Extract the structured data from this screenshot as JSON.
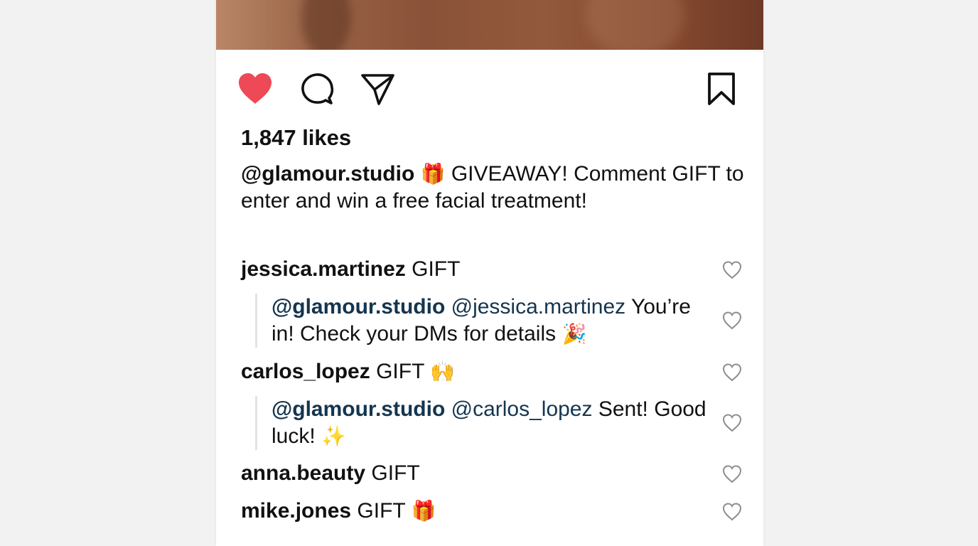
{
  "post": {
    "likes": "1,847 likes",
    "caption_user": "@glamour.studio",
    "caption_emoji": "🎁",
    "caption_text": "GIVEAWAY! Comment GIFT to enter and win a free facial treatment!"
  },
  "colors": {
    "like_active": "#ed4956",
    "mention": "#14354f",
    "icon": "#111111",
    "comment_heart": "#8e8e8e"
  },
  "actions": {
    "like_icon": "heart-filled-icon",
    "comment_icon": "comment-bubble-icon",
    "share_icon": "paper-plane-icon",
    "save_icon": "bookmark-icon"
  },
  "comments": [
    {
      "user": "jessica.martinez",
      "text": "GIFT",
      "emoji": ""
    },
    {
      "user": "carlos_lopez",
      "text": "GIFT",
      "emoji": "🙌"
    },
    {
      "user": "anna.beauty",
      "text": "GIFT",
      "emoji": ""
    },
    {
      "user": "mike.jones",
      "text": "GIFT",
      "emoji": "🎁"
    }
  ],
  "replies": [
    {
      "author": "@glamour.studio",
      "mention": "@jessica.martinez",
      "text": "You’re in! Check your DMs for details",
      "emoji": "🎉"
    },
    {
      "author": "@glamour.studio",
      "mention": "@carlos_lopez",
      "text": "Sent! Good luck!",
      "emoji": "✨"
    }
  ]
}
